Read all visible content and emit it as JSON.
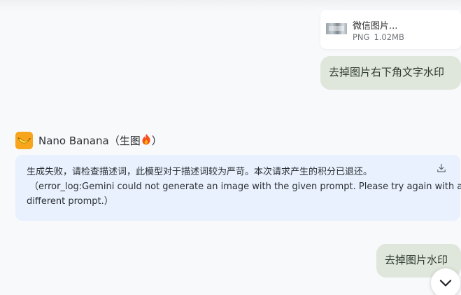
{
  "attachment": {
    "file_name": "微信图片...",
    "file_type": "PNG",
    "file_size": "1.02MB"
  },
  "messages": {
    "user_1": "去掉图片右下角文字水印",
    "user_2": "去掉图片水印"
  },
  "model": {
    "name_prefix": "Nano Banana（生图",
    "name_suffix": "）",
    "avatar_icon": "banana-icon",
    "badge_icon": "fire-icon",
    "avatar_color": "#f6a51c"
  },
  "response": {
    "line1": "生成失败，请检查描述词，此模型对于描述词较为严苛。本次请求产生的积分已退还。",
    "line2": "（error_log:Gemini could not generate an image with the given prompt. Please try again with a",
    "line3": "different prompt.）",
    "background": "#e8f1fd"
  },
  "controls": {
    "download_icon": "download-icon",
    "scroll_icon": "chevron-down-icon"
  }
}
